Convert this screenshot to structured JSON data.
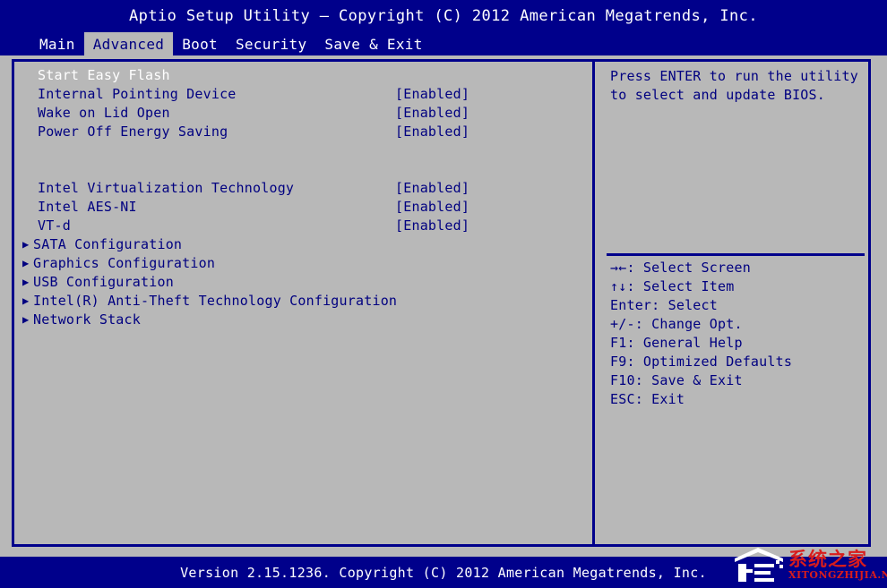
{
  "window": {
    "title": "Aptio Setup Utility – Copyright (C) 2012 American Megatrends, Inc.",
    "footer": "Version 2.15.1236. Copyright (C) 2012 American Megatrends, Inc."
  },
  "colors": {
    "background": "#00008b",
    "panel": "#b8b8b8",
    "text": "#000080",
    "highlight_text": "#ffffff",
    "border": "#00008b",
    "watermark": "#d81d1d"
  },
  "tabs": [
    {
      "label": "Main",
      "active": false
    },
    {
      "label": "Advanced",
      "active": true
    },
    {
      "label": "Boot",
      "active": false
    },
    {
      "label": "Security",
      "active": false
    },
    {
      "label": "Save & Exit",
      "active": false
    }
  ],
  "menu": {
    "rows": [
      {
        "label": "Start Easy Flash",
        "value": "",
        "arrow": "",
        "selected": true,
        "spacer": false
      },
      {
        "label": "Internal Pointing Device",
        "value": "[Enabled]",
        "arrow": "",
        "selected": false,
        "spacer": false
      },
      {
        "label": "Wake on Lid Open",
        "value": "[Enabled]",
        "arrow": "",
        "selected": false,
        "spacer": false
      },
      {
        "label": "Power Off Energy Saving",
        "value": "[Enabled]",
        "arrow": "",
        "selected": false,
        "spacer": false
      },
      {
        "label": "",
        "value": "",
        "arrow": "",
        "selected": false,
        "spacer": true
      },
      {
        "label": "",
        "value": "",
        "arrow": "",
        "selected": false,
        "spacer": true
      },
      {
        "label": "Intel Virtualization Technology",
        "value": "[Enabled]",
        "arrow": "",
        "selected": false,
        "spacer": false
      },
      {
        "label": "Intel AES-NI",
        "value": "[Enabled]",
        "arrow": "",
        "selected": false,
        "spacer": false
      },
      {
        "label": "VT-d",
        "value": "[Enabled]",
        "arrow": "",
        "selected": false,
        "spacer": false
      },
      {
        "label": "SATA Configuration",
        "value": "",
        "arrow": "▶",
        "selected": false,
        "spacer": false
      },
      {
        "label": "Graphics Configuration",
        "value": "",
        "arrow": "▶",
        "selected": false,
        "spacer": false
      },
      {
        "label": "USB Configuration",
        "value": "",
        "arrow": "▶",
        "selected": false,
        "spacer": false
      },
      {
        "label": "Intel(R) Anti-Theft Technology Configuration",
        "value": "",
        "arrow": "▶",
        "selected": false,
        "spacer": false
      },
      {
        "label": "Network Stack",
        "value": "",
        "arrow": "▶",
        "selected": false,
        "spacer": false
      }
    ]
  },
  "help": {
    "lines": [
      "Press ENTER to run the utility",
      "to select and update BIOS."
    ]
  },
  "legend": {
    "lines": [
      "→←: Select Screen",
      "↑↓: Select Item",
      "Enter: Select",
      "+/-: Change Opt.",
      "F1: General Help",
      "F9: Optimized Defaults",
      "F10: Save & Exit",
      "ESC: Exit"
    ]
  },
  "watermark": {
    "chinese": "系统之家",
    "english": "XITONGZHIJIA.NET"
  }
}
